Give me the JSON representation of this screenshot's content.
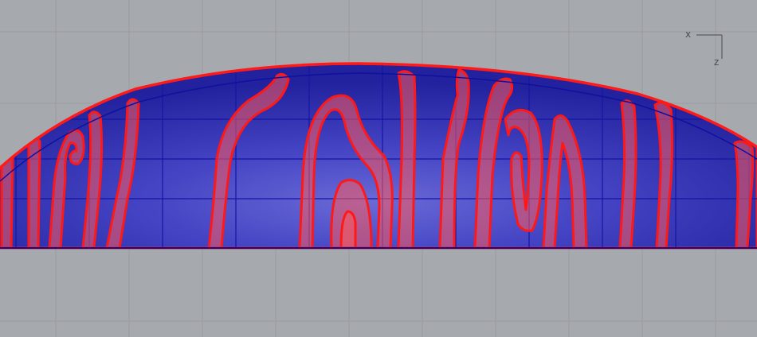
{
  "viewport": {
    "view": "side",
    "background_color": "#a6a9ad",
    "grid_color": "#9a9da1",
    "grid_major_color": "#8e9195"
  },
  "axis_gizmo": {
    "x_label": "x",
    "z_label": "z",
    "color": "#4b4e52"
  },
  "model": {
    "shape": "lens-shaped dome cross-section",
    "body_color": "#2f2fb8",
    "body_highlight_color": "#6a6ad6",
    "mesh_color": "#1212a0",
    "stripe_color": "#ff1a1a",
    "stripe_fill_color": "#ff5a5a"
  }
}
